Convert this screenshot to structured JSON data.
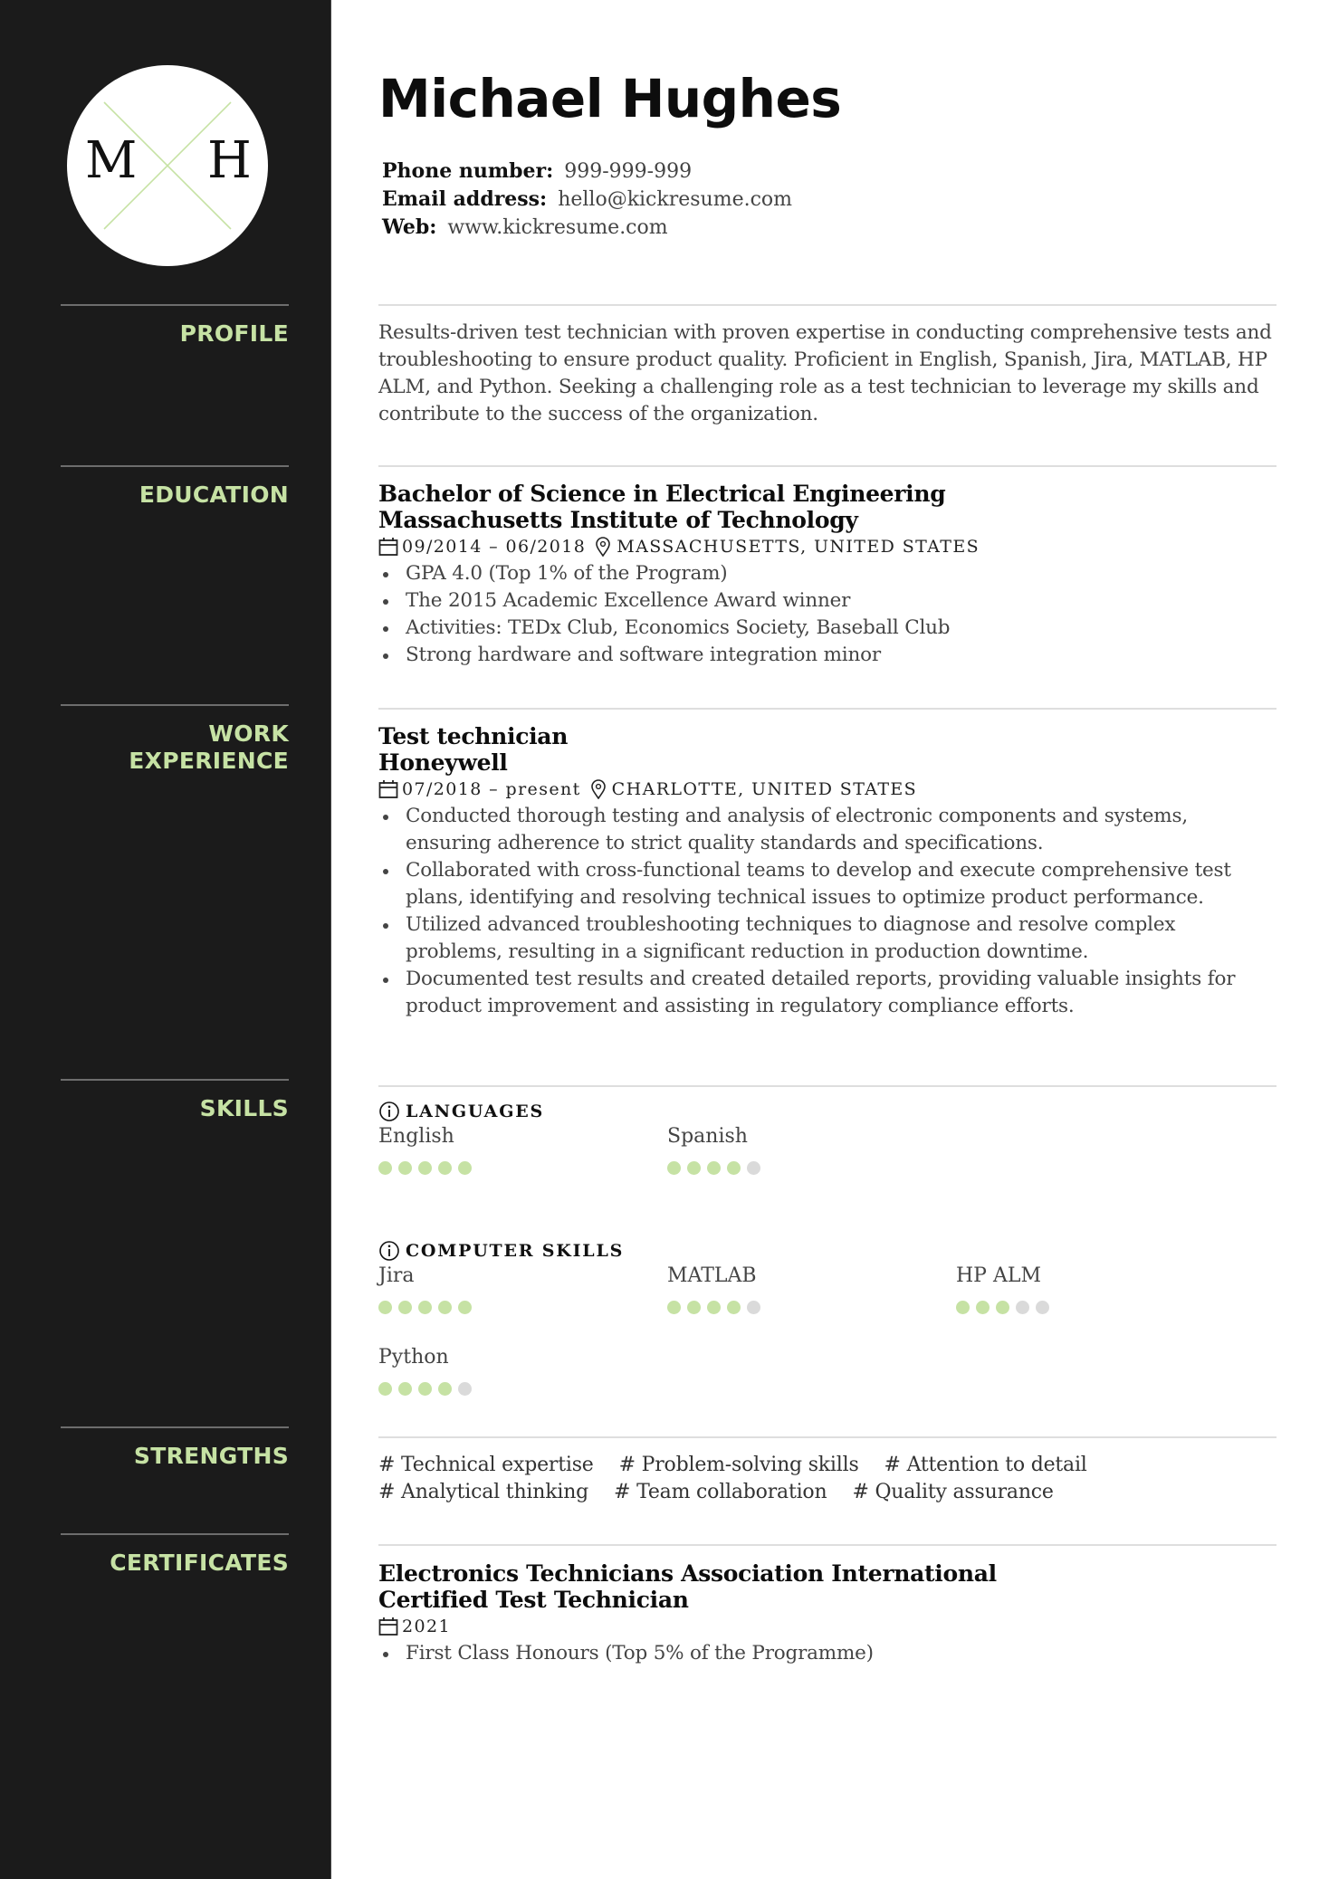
{
  "colors": {
    "accent": "#c6e2a4",
    "sidebar_bg": "#1b1b1b",
    "dot_off": "#dadada"
  },
  "logo": {
    "initials": [
      "M",
      "H"
    ]
  },
  "header": {
    "name": "Michael Hughes",
    "contacts": [
      {
        "label": "Phone number:",
        "value": "999-999-999"
      },
      {
        "label": "Email address:",
        "value": "hello@kickresume.com"
      },
      {
        "label": "Web:",
        "value": "www.kickresume.com"
      }
    ]
  },
  "sidebar": {
    "profile": "PROFILE",
    "education": "EDUCATION",
    "work_1": "WORK",
    "work_2": "EXPERIENCE",
    "skills": "SKILLS",
    "strengths": "STRENGTHS",
    "certificates": "CERTIFICATES"
  },
  "profile": {
    "text": "Results-driven test technician with proven expertise in conducting comprehensive tests and troubleshooting to ensure product quality. Proficient in English, Spanish, Jira, MATLAB, HP ALM, and Python. Seeking a challenging role as a test technician to leverage my skills and contribute to the success of the organization."
  },
  "education": {
    "degree": "Bachelor of Science in Electrical Engineering",
    "school": "Massachusetts Institute of Technology",
    "dates": "09/2014 – 06/2018",
    "location": "MASSACHUSETTS, UNITED STATES",
    "bullets": [
      "GPA 4.0 (Top 1% of the Program)",
      "The 2015 Academic Excellence Award winner",
      "Activities: TEDx Club, Economics Society, Baseball Club",
      "Strong hardware and software integration minor"
    ]
  },
  "work": {
    "title": "Test technician",
    "company": "Honeywell",
    "dates": "07/2018 – present",
    "location": "CHARLOTTE, UNITED STATES",
    "bullets": [
      "Conducted thorough testing and analysis of electronic components and systems, ensuring adherence to strict quality standards and specifications.",
      "Collaborated with cross-functional teams to develop and execute comprehensive test plans, identifying and resolving technical issues to optimize product performance.",
      "Utilized advanced troubleshooting techniques to diagnose and resolve complex problems, resulting in a significant reduction in production downtime.",
      "Documented test results and created detailed reports, providing valuable insights for product improvement and assisting in regulatory compliance efforts."
    ]
  },
  "skills": {
    "languages_title": "LANGUAGES",
    "languages": [
      {
        "name": "English",
        "level": 5,
        "max": 5
      },
      {
        "name": "Spanish",
        "level": 4,
        "max": 5
      }
    ],
    "computer_title": "COMPUTER SKILLS",
    "computer": [
      {
        "name": "Jira",
        "level": 5,
        "max": 5
      },
      {
        "name": "MATLAB",
        "level": 4,
        "max": 5
      },
      {
        "name": "HP ALM",
        "level": 3,
        "max": 5
      },
      {
        "name": "Python",
        "level": 4,
        "max": 5
      }
    ]
  },
  "strengths": {
    "line1": [
      "# Technical expertise",
      "# Problem-solving skills",
      "# Attention to detail"
    ],
    "line2": [
      "# Analytical thinking",
      "# Team collaboration",
      "# Quality assurance"
    ]
  },
  "certificates": {
    "org": "Electronics Technicians Association International",
    "name": "Certified Test Technician",
    "year": "2021",
    "bullets": [
      "First Class Honours (Top 5% of the Programme)"
    ]
  }
}
